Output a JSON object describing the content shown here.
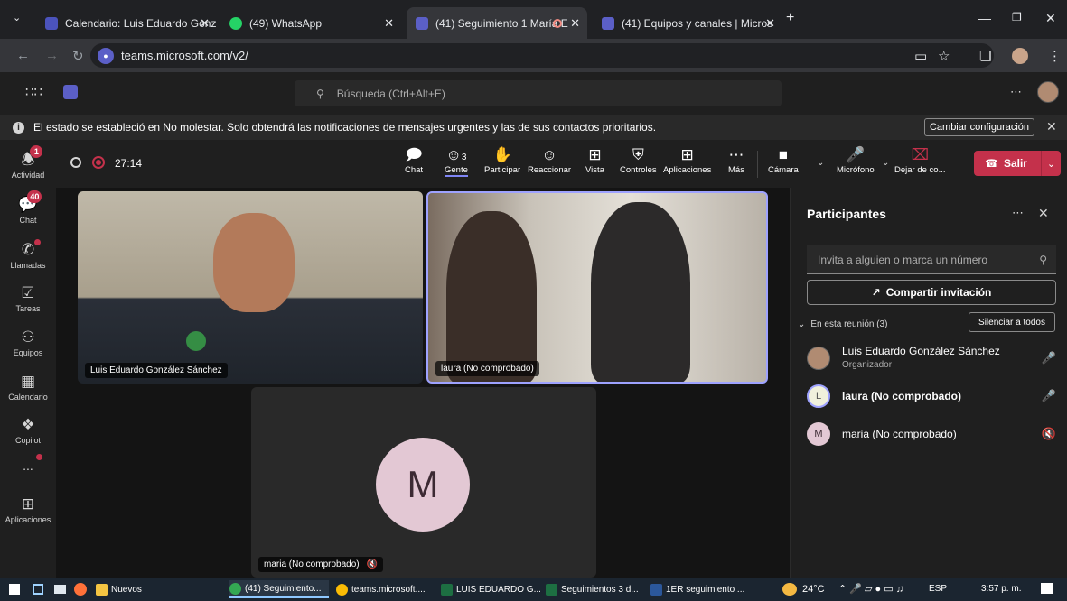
{
  "browser": {
    "tabs": [
      {
        "label": "Calendario: Luis Eduardo Gonzá",
        "color": "#4b53bc"
      },
      {
        "label": "(49) WhatsApp",
        "color": "#25d366"
      },
      {
        "label": "(41) Seguimiento 1 María E",
        "color": "#5b5fc7"
      },
      {
        "label": "(41) Equipos y canales | Micros",
        "color": "#5b5fc7"
      }
    ],
    "url": "teams.microsoft.com/v2/"
  },
  "teams": {
    "search_placeholder": "Búsqueda (Ctrl+Alt+E)",
    "notice": "El estado se estableció en No molestar. Solo obtendrá las notificaciones de mensajes urgentes y las de sus contactos prioritarios.",
    "notice_button": "Cambiar configuración"
  },
  "rail": {
    "activity": "Actividad",
    "activity_badge": "1",
    "chat": "Chat",
    "chat_badge": "40",
    "calls": "Llamadas",
    "tasks": "Tareas",
    "teams": "Equipos",
    "calendar": "Calendario",
    "copilot": "Copilot",
    "more": "...",
    "apps": "Aplicaciones"
  },
  "meeting": {
    "timer": "27:14",
    "people_count": "3",
    "tools": {
      "chat": "Chat",
      "people": "Gente",
      "raise": "Participar",
      "react": "Reaccionar",
      "view": "Vista",
      "controls": "Controles",
      "apps": "Aplicaciones",
      "more": "Más",
      "camera": "Cámara",
      "mic": "Micrófono",
      "share": "Dejar de co..."
    },
    "leave": "Salir",
    "tiles": {
      "luis": "Luis Eduardo González Sánchez",
      "laura": "laura (No comprobado)",
      "maria": "maria (No comprobado)",
      "maria_initial": "M"
    }
  },
  "panel": {
    "title": "Participantes",
    "invite_placeholder": "Invita a alguien o marca un número",
    "share_invite": "Compartir invitación",
    "section": "En esta reunión (3)",
    "mute_all": "Silenciar a todos",
    "participants": [
      {
        "name": "Luis Eduardo González Sánchez",
        "role": "Organizador",
        "initial": ""
      },
      {
        "name": "laura (No comprobado)",
        "role": "",
        "initial": "L"
      },
      {
        "name": "maria (No comprobado)",
        "role": "",
        "initial": "M"
      }
    ]
  },
  "taskbar": {
    "items": [
      "Nuevos",
      "(41) Seguimiento...",
      "teams.microsoft....",
      "LUIS EDUARDO G...",
      "Seguimientos 3 d...",
      "1ER seguimiento ..."
    ],
    "weather": "24°C",
    "lang": "ESP",
    "time": "3:57 p. m."
  }
}
